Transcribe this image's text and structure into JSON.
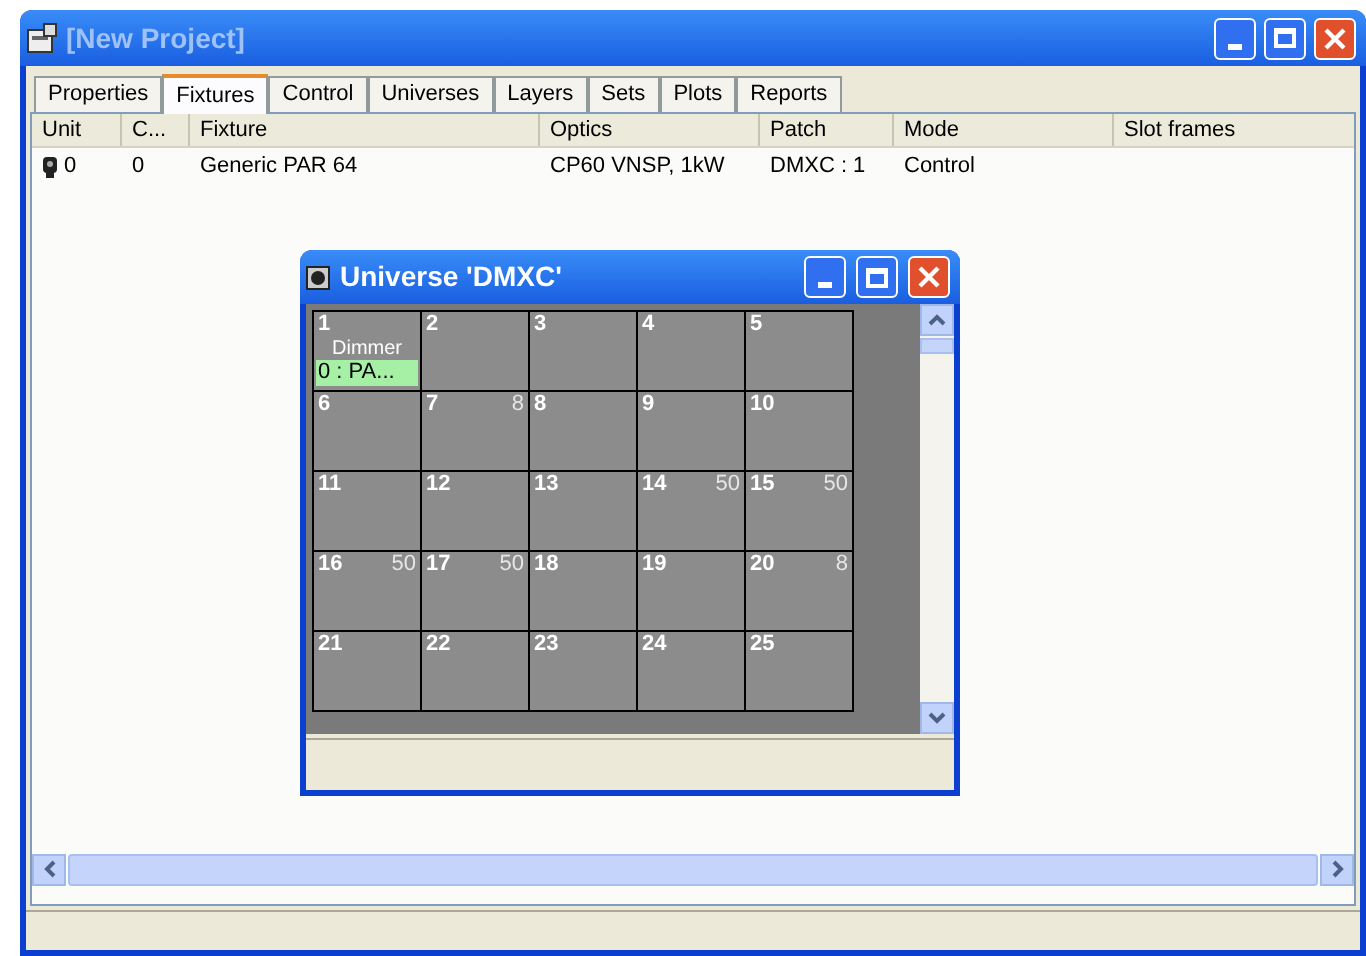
{
  "window": {
    "title": "[New Project]"
  },
  "tabs": [
    {
      "label": "Properties",
      "selected": false
    },
    {
      "label": "Fixtures",
      "selected": true
    },
    {
      "label": "Control",
      "selected": false
    },
    {
      "label": "Universes",
      "selected": false
    },
    {
      "label": "Layers",
      "selected": false
    },
    {
      "label": "Sets",
      "selected": false
    },
    {
      "label": "Plots",
      "selected": false
    },
    {
      "label": "Reports",
      "selected": false
    }
  ],
  "table": {
    "columns": [
      "Unit",
      "C...",
      "Fixture",
      "Optics",
      "Patch",
      "Mode",
      "Slot frames"
    ],
    "rows": [
      [
        "0",
        "0",
        "Generic PAR 64",
        "CP60 VNSP, 1kW",
        "DMXC : 1",
        "Control"
      ]
    ]
  },
  "universe_window": {
    "title": "Universe 'DMXC'",
    "slots": [
      {
        "number": "1",
        "label": "Dimmer",
        "patch": "0 : PA..."
      },
      {
        "number": "2"
      },
      {
        "number": "3"
      },
      {
        "number": "4"
      },
      {
        "number": "5"
      },
      {
        "number": "6"
      },
      {
        "number": "7",
        "value": "8"
      },
      {
        "number": "8"
      },
      {
        "number": "9"
      },
      {
        "number": "10"
      },
      {
        "number": "11"
      },
      {
        "number": "12"
      },
      {
        "number": "13"
      },
      {
        "number": "14",
        "value": "50"
      },
      {
        "number": "15",
        "value": "50"
      },
      {
        "number": "16",
        "value": "50"
      },
      {
        "number": "17",
        "value": "50"
      },
      {
        "number": "18"
      },
      {
        "number": "19"
      },
      {
        "number": "20",
        "value": "8"
      },
      {
        "number": "21"
      },
      {
        "number": "22"
      },
      {
        "number": "23"
      },
      {
        "number": "24"
      },
      {
        "number": "25"
      }
    ]
  }
}
